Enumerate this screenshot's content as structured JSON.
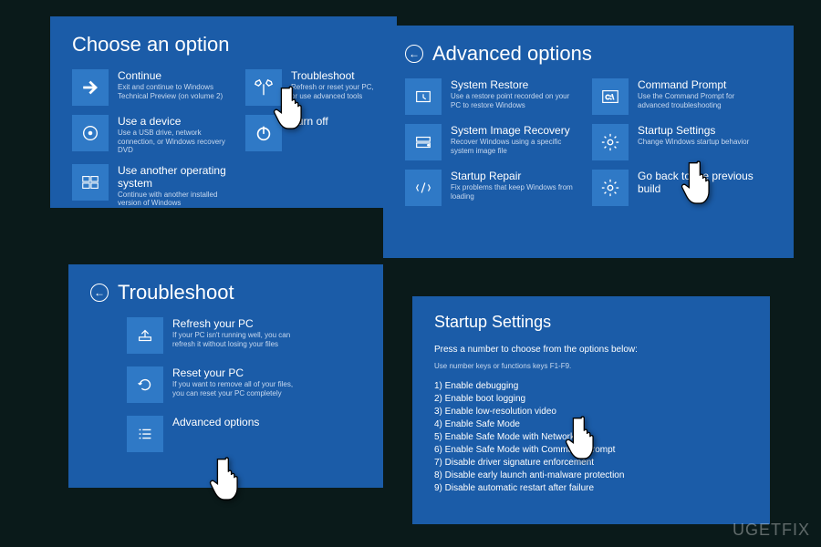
{
  "pane1": {
    "title": "Choose an option",
    "tiles": {
      "continue": {
        "label": "Continue",
        "desc": "Exit and continue to Windows Technical Preview (on volume 2)"
      },
      "troubleshoot": {
        "label": "Troubleshoot",
        "desc": "Refresh or reset your PC, or use advanced tools"
      },
      "device": {
        "label": "Use a device",
        "desc": "Use a USB drive, network connection, or Windows recovery DVD"
      },
      "turnoff": {
        "label": "Turn off"
      },
      "os": {
        "label": "Use another operating system",
        "desc": "Continue with another installed version of Windows"
      }
    }
  },
  "pane2": {
    "title": "Advanced options",
    "tiles": {
      "restore": {
        "label": "System Restore",
        "desc": "Use a restore point recorded on your PC to restore Windows"
      },
      "cmd": {
        "label": "Command Prompt",
        "desc": "Use the Command Prompt for advanced troubleshooting"
      },
      "image": {
        "label": "System Image Recovery",
        "desc": "Recover Windows using a specific system image file"
      },
      "startup": {
        "label": "Startup Settings",
        "desc": "Change Windows startup behavior"
      },
      "repair": {
        "label": "Startup Repair",
        "desc": "Fix problems that keep Windows from loading"
      },
      "goback": {
        "label": "Go back to the previous build"
      }
    }
  },
  "pane3": {
    "title": "Troubleshoot",
    "tiles": {
      "refresh": {
        "label": "Refresh your PC",
        "desc": "If your PC isn't running well, you can refresh it without losing your files"
      },
      "reset": {
        "label": "Reset your PC",
        "desc": "If you want to remove all of your files, you can reset your PC completely"
      },
      "advanced": {
        "label": "Advanced options"
      }
    }
  },
  "pane4": {
    "title": "Startup Settings",
    "sub": "Press a number to choose from the options below:",
    "hint": "Use number keys or functions keys F1-F9.",
    "items": [
      "1) Enable debugging",
      "2) Enable boot logging",
      "3) Enable low-resolution video",
      "4) Enable Safe Mode",
      "5) Enable Safe Mode with Networking",
      "6) Enable Safe Mode with Command Prompt",
      "7) Disable driver signature enforcement",
      "8) Disable early launch anti-malware protection",
      "9) Disable automatic restart after failure"
    ]
  },
  "watermark": "UGETFIX"
}
